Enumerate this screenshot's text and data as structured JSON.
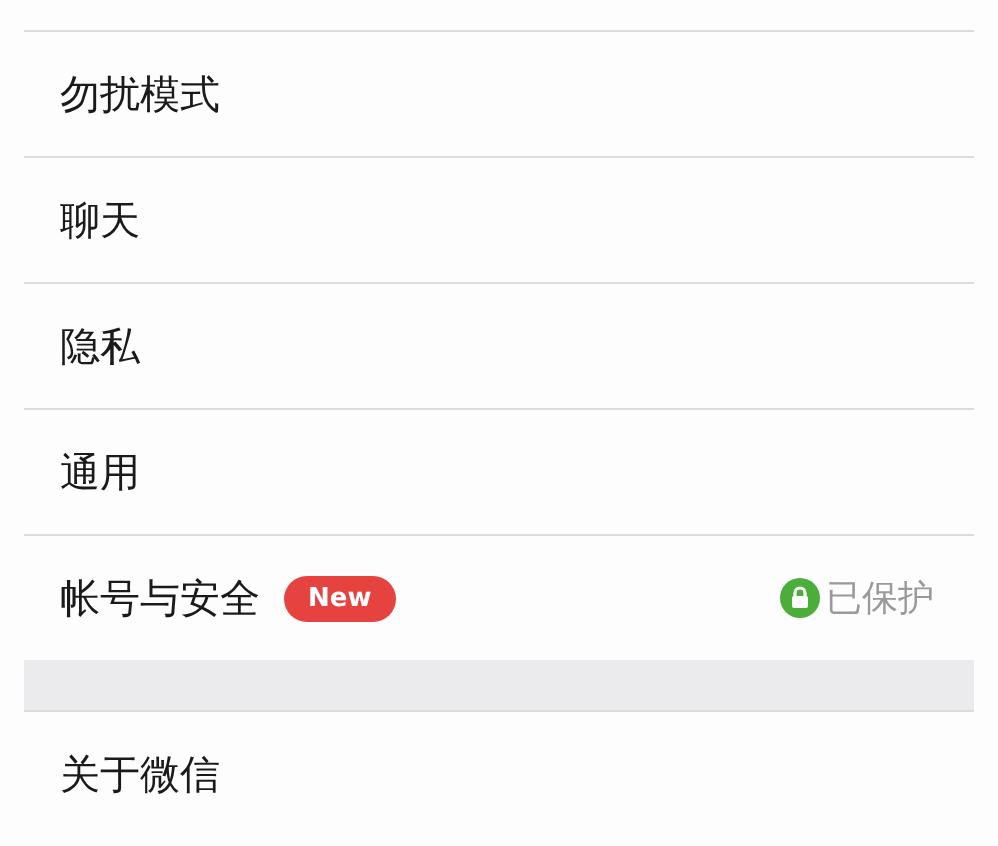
{
  "groups": [
    {
      "items": [
        {
          "label": "勿扰模式"
        },
        {
          "label": "聊天"
        },
        {
          "label": "隐私"
        },
        {
          "label": "通用"
        },
        {
          "label": "帐号与安全",
          "badge": "New",
          "status": "已保护"
        }
      ]
    },
    {
      "items": [
        {
          "label": "关于微信"
        }
      ]
    }
  ]
}
